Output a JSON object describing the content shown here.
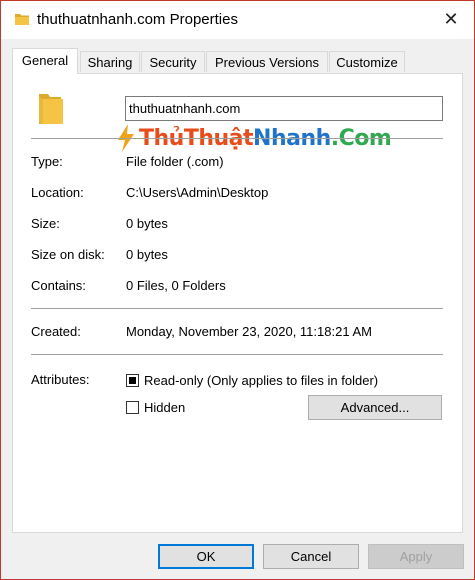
{
  "window": {
    "title": "thuthuatnhanh.com Properties",
    "close_glyph": "✕"
  },
  "tabs": [
    {
      "label": "General",
      "active": true
    },
    {
      "label": "Sharing",
      "active": false
    },
    {
      "label": "Security",
      "active": false
    },
    {
      "label": "Previous Versions",
      "active": false
    },
    {
      "label": "Customize",
      "active": false
    }
  ],
  "general": {
    "name_value": "thuthuatnhanh.com",
    "watermark": {
      "part1": "Thủ",
      "part2": "Thuật",
      "part3": "Nhanh",
      "part4": ".Com"
    },
    "rows": [
      {
        "label": "Type:",
        "value": "File folder (.com)"
      },
      {
        "label": "Location:",
        "value": "C:\\Users\\Admin\\Desktop"
      },
      {
        "label": "Size:",
        "value": "0 bytes"
      },
      {
        "label": "Size on disk:",
        "value": "0 bytes"
      },
      {
        "label": "Contains:",
        "value": "0 Files, 0 Folders"
      }
    ],
    "created": {
      "label": "Created:",
      "value": "Monday, November 23, 2020, 11:18:21 AM"
    },
    "attributes": {
      "label": "Attributes:",
      "readonly_label": "Read-only (Only applies to files in folder)",
      "readonly_checked": true,
      "hidden_label": "Hidden",
      "hidden_checked": false,
      "advanced_label": "Advanced..."
    }
  },
  "buttons": {
    "ok": "OK",
    "cancel": "Cancel",
    "apply": "Apply"
  },
  "colors": {
    "folder": "#f6c445",
    "accent": "#0078d7"
  }
}
